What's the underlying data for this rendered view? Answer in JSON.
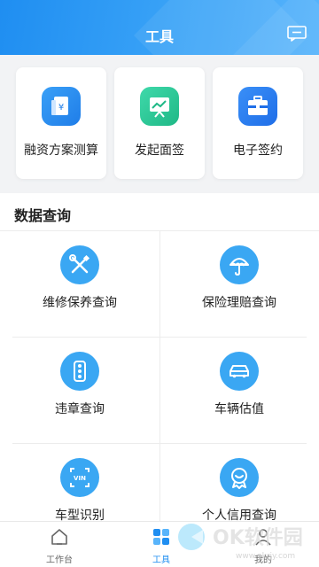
{
  "header": {
    "title": "工具"
  },
  "tools": [
    {
      "label": "融资方案测算",
      "icon": "finance-calc-icon",
      "color": "#2f8cf0"
    },
    {
      "label": "发起面签",
      "icon": "presentation-icon",
      "color": "#2ec99a"
    },
    {
      "label": "电子签约",
      "icon": "briefcase-icon",
      "color": "#2f7ef0"
    }
  ],
  "section": {
    "title": "数据查询",
    "items": [
      {
        "label": "维修保养查询",
        "icon": "tools-icon"
      },
      {
        "label": "保险理赔查询",
        "icon": "umbrella-icon"
      },
      {
        "label": "违章查询",
        "icon": "traffic-light-icon"
      },
      {
        "label": "车辆估值",
        "icon": "car-icon"
      },
      {
        "label": "车型识别",
        "icon": "vin-scan-icon"
      },
      {
        "label": "个人信用查询",
        "icon": "credit-badge-icon"
      }
    ]
  },
  "tabbar": {
    "tabs": [
      {
        "label": "工作台",
        "icon": "home-icon"
      },
      {
        "label": "工具",
        "icon": "grid-icon",
        "active": true
      },
      {
        "label": "我的",
        "icon": "user-icon"
      }
    ]
  },
  "watermark": {
    "text": "OK软件园",
    "sub": "www.okrjy.com"
  },
  "colors": {
    "primary": "#1f8ef1",
    "icon_circle": "#3aa7f3"
  }
}
